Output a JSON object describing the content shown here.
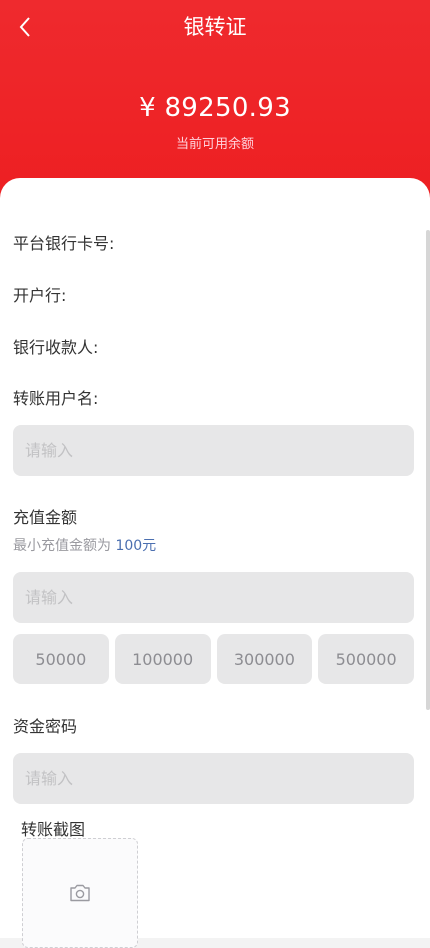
{
  "header": {
    "title": "银转证",
    "balance": "¥ 89250.93",
    "balance_label": "当前可用余额",
    "bg_color": "#ed2024"
  },
  "bank_info": {
    "card_number_label": "平台银行卡号:",
    "bank_branch_label": "开户行:",
    "payee_label": "银行收款人:"
  },
  "transfer_user": {
    "label": "转账用户名:",
    "placeholder": "请输入"
  },
  "recharge": {
    "label": "充值金额",
    "hint_prefix": "最小充值金额为 ",
    "hint_value": "100元",
    "placeholder": "请输入",
    "quick_amounts": [
      "50000",
      "100000",
      "300000",
      "500000"
    ]
  },
  "fund_password": {
    "label": "资金密码",
    "placeholder": "请输入"
  },
  "screenshot": {
    "label": "转账截图",
    "icon": "camera-icon"
  }
}
